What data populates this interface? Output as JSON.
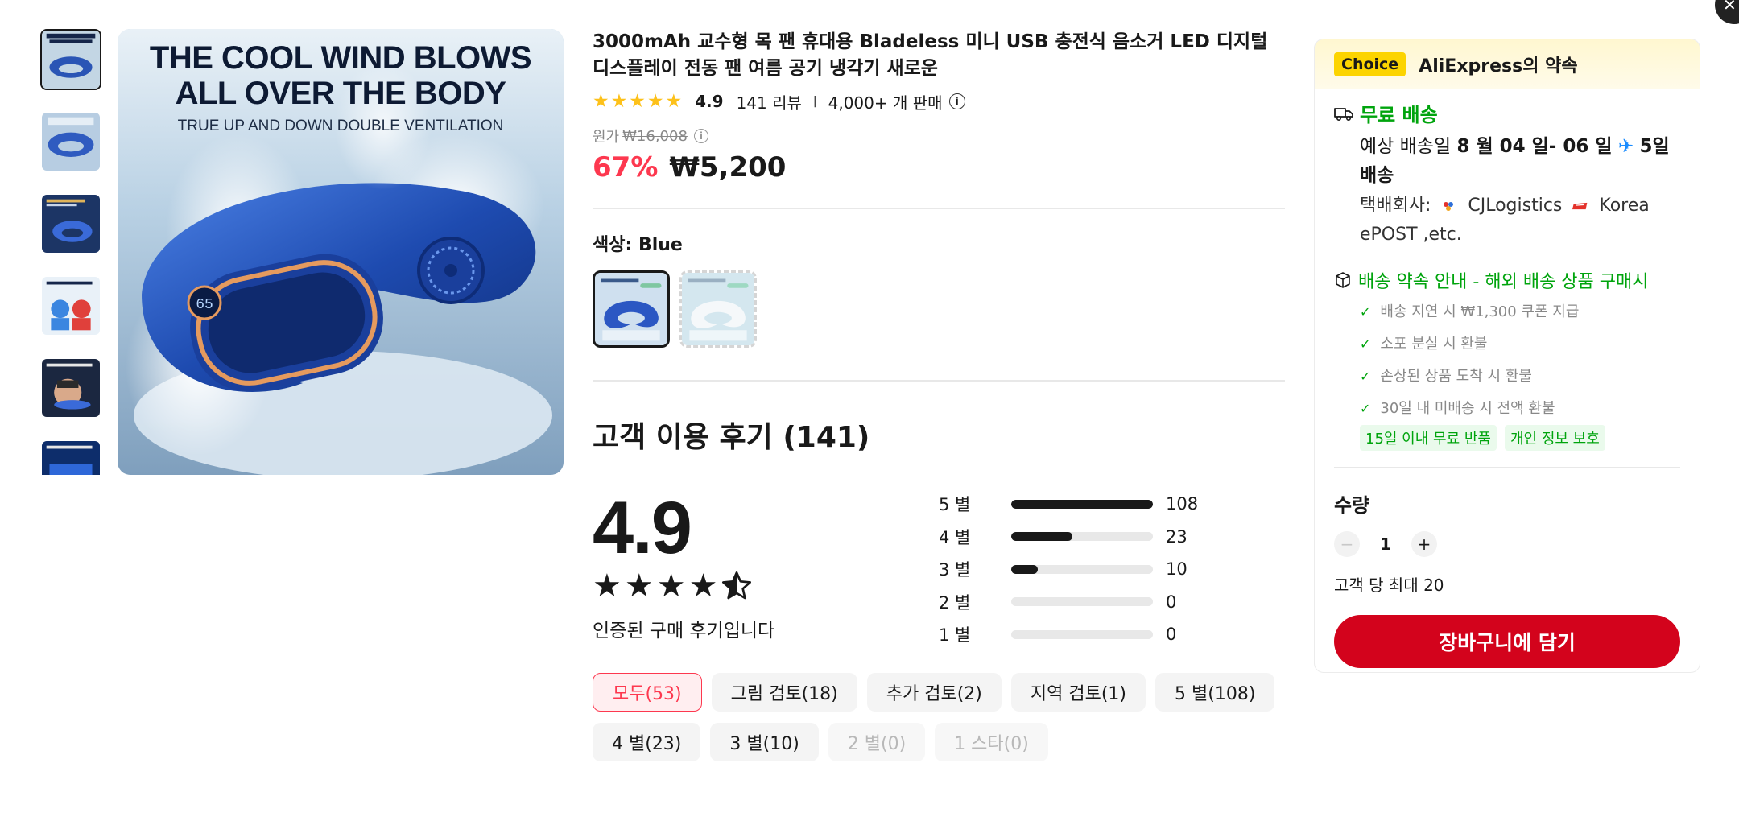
{
  "product": {
    "title": "3000mAh 교수형 목 팬 휴대용 Bladeless 미니 USB 충전식 음소거 LED 디지털 디스플레이 전동 팬 여름 공기 냉각기 새로운",
    "rating": "4.9",
    "review_count_text": "141 리뷰",
    "sold_text": "4,000+ 개 판매",
    "orig_price_label": "원가",
    "orig_price": "₩16,008",
    "discount": "67%",
    "price": "₩5,200",
    "color_label": "색상:",
    "color_value": "Blue",
    "swatches": [
      {
        "name": "Blue",
        "selected": true
      },
      {
        "name": "White",
        "selected": false
      }
    ],
    "image": {
      "headline1": "THE COOL WIND BLOWS",
      "headline2": "ALL OVER THE BODY",
      "subline": "TRUE UP AND DOWN DOUBLE VENTILATION",
      "display_digits": "65"
    },
    "thumbnails": [
      "thumb-1",
      "thumb-2",
      "thumb-3",
      "thumb-4",
      "thumb-5",
      "thumb-6"
    ]
  },
  "reviews": {
    "title": "고객 이용 후기 (141)",
    "score": "4.9",
    "verified_text": "인증된 구매 후기입니다",
    "distribution": [
      {
        "label": "5 별",
        "count": "108",
        "fraction": 1.0
      },
      {
        "label": "4 별",
        "count": "23",
        "fraction": 0.43
      },
      {
        "label": "3 별",
        "count": "10",
        "fraction": 0.19
      },
      {
        "label": "2 별",
        "count": "0",
        "fraction": 0
      },
      {
        "label": "1 별",
        "count": "0",
        "fraction": 0
      }
    ],
    "filters": [
      {
        "label": "모두(53)",
        "state": "active"
      },
      {
        "label": "그림 검토(18)",
        "state": "normal"
      },
      {
        "label": "추가 검토(2)",
        "state": "normal"
      },
      {
        "label": "지역 검토(1)",
        "state": "normal"
      },
      {
        "label": "5 별(108)",
        "state": "normal"
      },
      {
        "label": "4 별(23)",
        "state": "normal"
      },
      {
        "label": "3 별(10)",
        "state": "normal"
      },
      {
        "label": "2 별(0)",
        "state": "disabled"
      },
      {
        "label": "1 스타(0)",
        "state": "disabled"
      }
    ]
  },
  "side": {
    "choice_badge": "Choice",
    "choice_text": "AliExpress의 약속",
    "free_shipping": "무료 배송",
    "delivery_prefix": "예상 배송일",
    "delivery_dates": "8 월 04 일- 06 일",
    "delivery_days": "5일",
    "delivery_suffix": "배송",
    "carrier_prefix": "택배회사:",
    "carrier_1": "CJLogistics",
    "carrier_2": "Korea",
    "carrier_3": "ePOST ,etc.",
    "promise_title": "배송 약속 안내 - 해외 배송 상품 구매시",
    "promise_items": [
      "배송 지연 시 ₩1,300 쿠폰 지급",
      "소포 분실 시 환불",
      "손상된 상품 도착 시 환불",
      "30일 내 미배송 시 전액 환불"
    ],
    "tags": [
      "15일 이내 무료 반품",
      "개인 정보 보호"
    ],
    "quantity_title": "수량",
    "quantity_value": "1",
    "quantity_limit": "고객 당 최대 20",
    "cart_button": "장바구니에 담기"
  },
  "colors": {
    "accent_red": "#fd384f",
    "cart_red": "#d3031c",
    "green": "#00a40d",
    "star_gold": "#fdc11a",
    "choice_yellow": "#fcd400"
  }
}
